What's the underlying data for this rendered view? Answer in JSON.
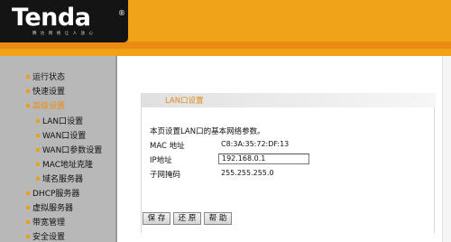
{
  "brand": {
    "logo_text": "Tenda",
    "registered_mark": "®",
    "tagline": "腾 达 网 络 让 人 放 心"
  },
  "colors": {
    "header_orange": "#f0a318",
    "header_band": "#eb8b12",
    "sidebar_gray": "#b8b8b8",
    "accent_orange": "#e08a18"
  },
  "sidebar": {
    "items": [
      {
        "label": "运行状态",
        "level": 1,
        "active": false
      },
      {
        "label": "快速设置",
        "level": 1,
        "active": false
      },
      {
        "label": "高级设置",
        "level": 1,
        "active": true
      },
      {
        "label": "LAN口设置",
        "level": 2,
        "active": false
      },
      {
        "label": "WAN口设置",
        "level": 2,
        "active": false
      },
      {
        "label": "WAN口参数设置",
        "level": 2,
        "active": false
      },
      {
        "label": "MAC地址克隆",
        "level": 2,
        "active": false
      },
      {
        "label": "域名服务器",
        "level": 2,
        "active": false
      },
      {
        "label": "DHCP服务器",
        "level": 1,
        "active": false
      },
      {
        "label": "虚拟服务器",
        "level": 1,
        "active": false
      },
      {
        "label": "带宽管理",
        "level": 1,
        "active": false
      },
      {
        "label": "安全设置",
        "level": 1,
        "active": false
      }
    ]
  },
  "panel": {
    "title": "LAN口设置",
    "description": "本页设置LAN口的基本网络参数。",
    "mac_label": "MAC 地址",
    "mac_value": "C8:3A:35:72:DF:13",
    "ip_label": "IP地址",
    "ip_value": "192.168.0.1",
    "mask_label": "子网掩码",
    "mask_value": "255.255.255.0"
  },
  "buttons": {
    "save": "保 存",
    "restore": "还 原",
    "help": "帮 助"
  }
}
